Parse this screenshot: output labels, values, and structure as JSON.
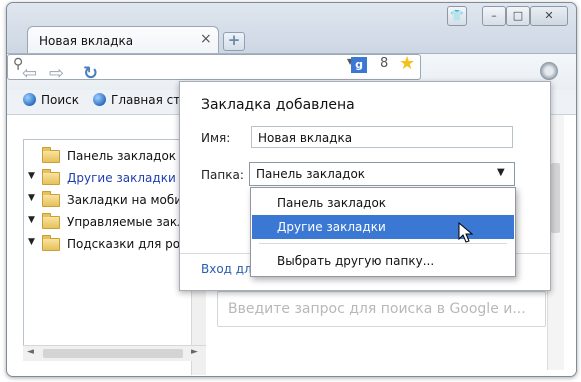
{
  "tab": {
    "title": "Новая вкладка",
    "close": "×",
    "new_tab": "+"
  },
  "window_controls": {
    "minimize": "–",
    "maximize": "□",
    "close": "✕",
    "profile": "👕"
  },
  "toolbar": {
    "back": "⇦",
    "forward": "⇨",
    "reload": "↻",
    "search_glyph": "⚲",
    "translate": "8",
    "star": "★"
  },
  "bookmarks_bar": {
    "items": [
      {
        "label": "Поиск"
      },
      {
        "label": "Главная стра"
      }
    ]
  },
  "tree": {
    "items": [
      {
        "label": "Панель закладок",
        "expanded": false,
        "selected": false
      },
      {
        "label": "Другие закладки",
        "expanded": true,
        "selected": true
      },
      {
        "label": "Закладки на мобиль",
        "expanded": true,
        "selected": false
      },
      {
        "label": "Управляемые заклад",
        "expanded": true,
        "selected": false
      },
      {
        "label": "Подсказки для родит",
        "expanded": true,
        "selected": false
      }
    ]
  },
  "search": {
    "placeholder": "Введите запрос для поиска в Google и..."
  },
  "bubble": {
    "title": "Закладка добавлена",
    "name_label": "Имя:",
    "name_value": "Новая вкладка",
    "folder_label": "Папка:",
    "folder_value": "Панель закладок",
    "link": "Вход для"
  },
  "dropdown": {
    "options": [
      {
        "label": "Панель закладок",
        "selected": false
      },
      {
        "label": "Другие закладки",
        "selected": true
      },
      {
        "label": "Выбрать другую папку...",
        "selected": false
      }
    ]
  },
  "colors": {
    "accent": "#3b78d4",
    "link": "#2a5db0",
    "selected_text": "#1f3fb0"
  }
}
